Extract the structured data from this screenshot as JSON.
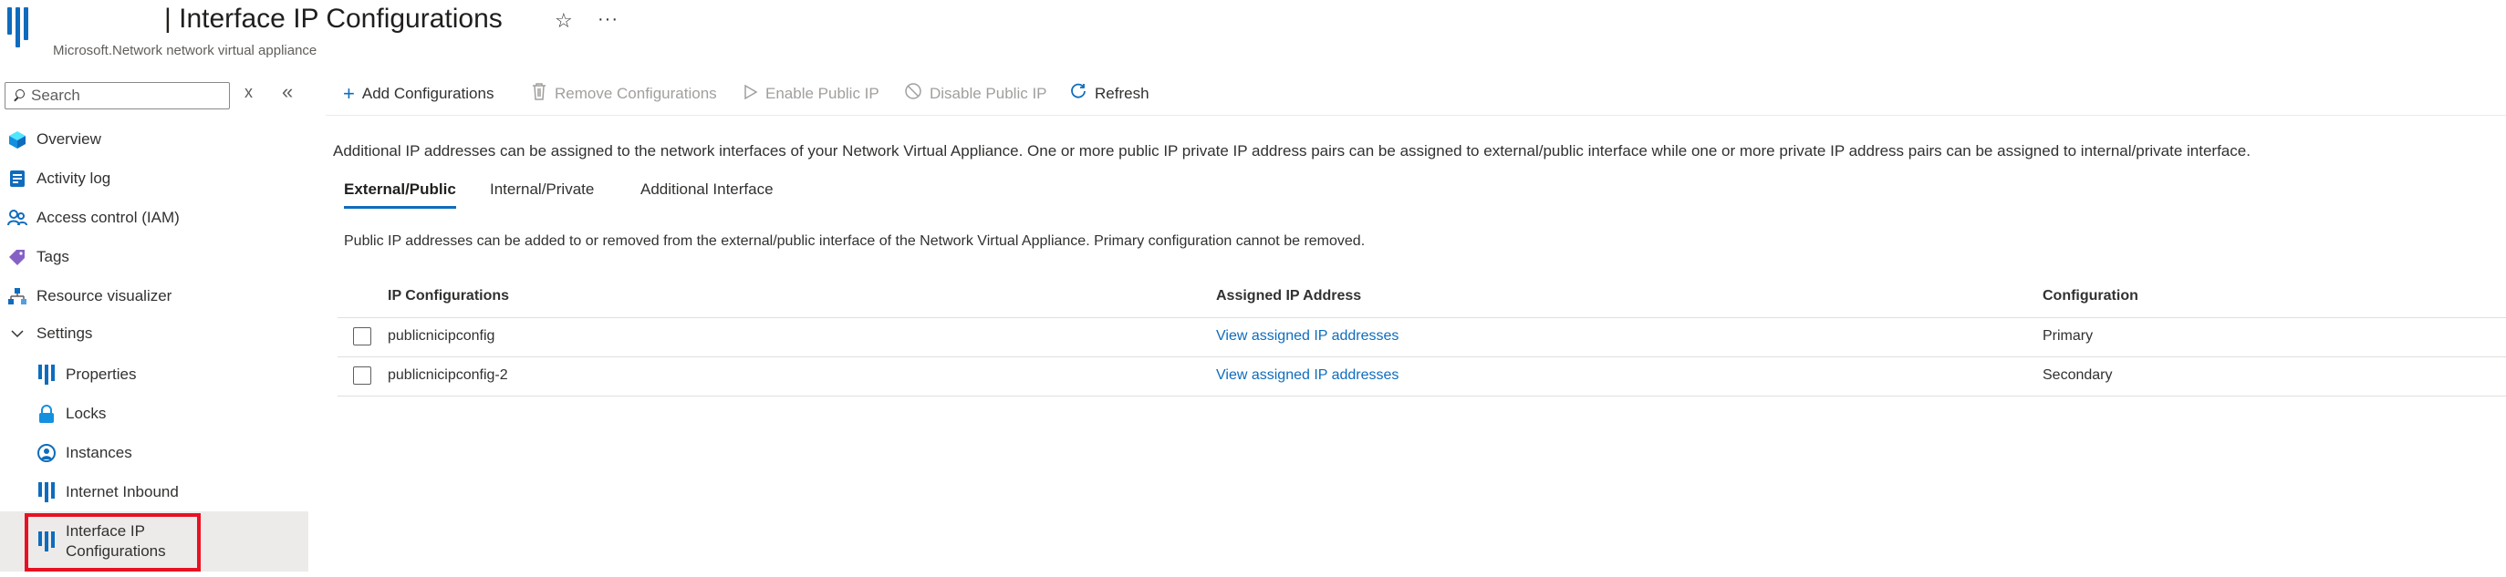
{
  "header": {
    "title": "| Interface IP Configurations",
    "subtitle": "Microsoft.Network network virtual appliance"
  },
  "sidebar": {
    "search_placeholder": "Search",
    "clear_label": "x",
    "collapse_label": "«",
    "items": [
      {
        "label": "Overview",
        "icon": "overview-cube-icon"
      },
      {
        "label": "Activity log",
        "icon": "activity-log-icon"
      },
      {
        "label": "Access control (IAM)",
        "icon": "people-icon"
      },
      {
        "label": "Tags",
        "icon": "tag-icon"
      },
      {
        "label": "Resource visualizer",
        "icon": "hierarchy-icon"
      },
      {
        "label": "Settings",
        "icon": "chevron-down-icon"
      },
      {
        "label": "Properties",
        "icon": "bars-icon"
      },
      {
        "label": "Locks",
        "icon": "lock-icon"
      },
      {
        "label": "Instances",
        "icon": "instances-icon"
      },
      {
        "label": "Internet Inbound",
        "icon": "bars-icon"
      },
      {
        "label": "Interface IP Configurations",
        "icon": "bars-icon",
        "selected": true
      }
    ]
  },
  "toolbar": {
    "add": "Add Configurations",
    "remove": "Remove Configurations",
    "enable": "Enable Public IP",
    "disable": "Disable Public IP",
    "refresh": "Refresh"
  },
  "main": {
    "description": "Additional IP addresses can be assigned to the network interfaces of your Network Virtual Appliance. One or more public IP private IP address pairs can be assigned to external/public interface while one or more private IP address pairs can be assigned to internal/private interface.",
    "tabs": [
      "External/Public",
      "Internal/Private",
      "Additional Interface"
    ],
    "active_tab": "External/Public",
    "tab_description": "Public IP addresses can be added to or removed from the external/public interface of the Network Virtual Appliance. Primary configuration cannot be removed.",
    "table": {
      "columns": [
        "IP Configurations",
        "Assigned IP Address",
        "Configuration"
      ],
      "rows": [
        {
          "name": "publicnicipconfig",
          "assigned": "View assigned IP addresses",
          "configuration": "Primary"
        },
        {
          "name": "publicnicipconfig-2",
          "assigned": "View assigned IP addresses",
          "configuration": "Secondary"
        }
      ]
    }
  },
  "colors": {
    "accent": "#0f6cbd",
    "highlight": "#e81123",
    "selected_bg": "#edebe9"
  }
}
